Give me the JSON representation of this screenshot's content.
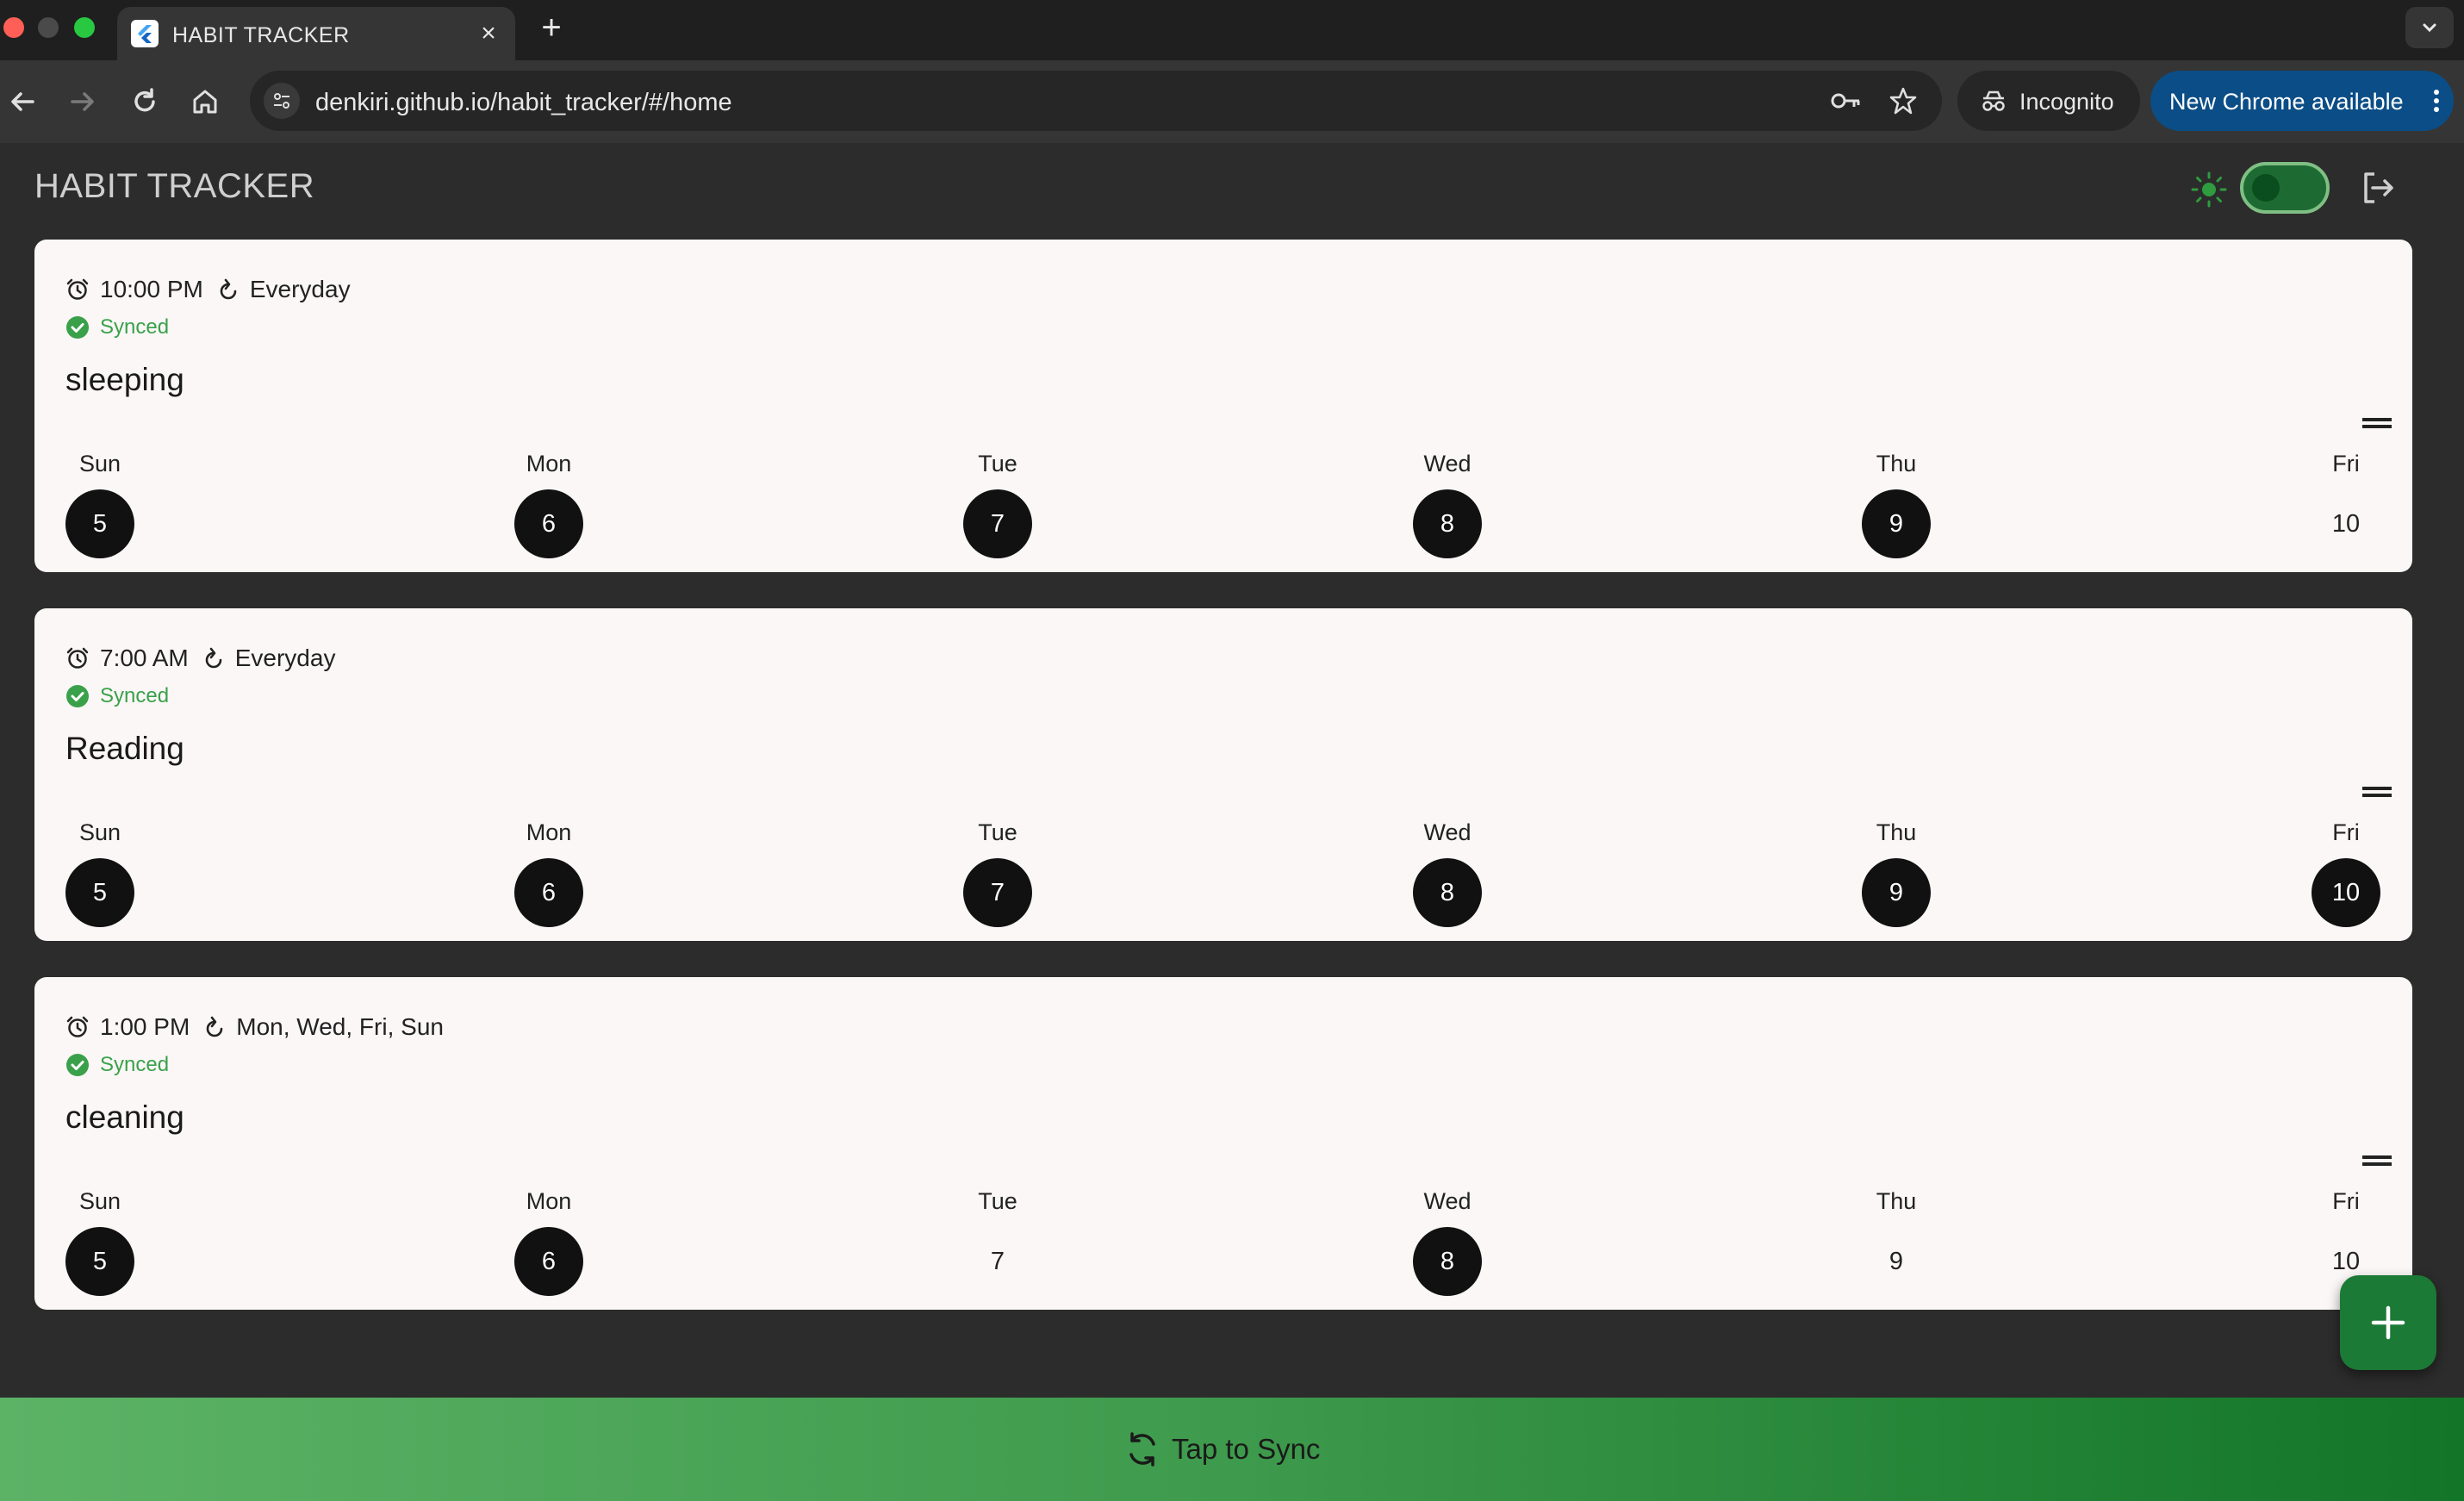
{
  "browser": {
    "tab_title": "HABIT TRACKER",
    "url": "denkiri.github.io/habit_tracker/#/home",
    "incognito_label": "Incognito",
    "update_label": "New Chrome available"
  },
  "app": {
    "title": "HABIT TRACKER",
    "theme_switch_on": true,
    "accent_color": "#1b7a35",
    "synced_color": "#3aa14a"
  },
  "habits": [
    {
      "time": "10:00 PM",
      "repeat": "Everyday",
      "status": "Synced",
      "name": "sleeping",
      "days": [
        {
          "label": "Sun",
          "num": "5",
          "done": true
        },
        {
          "label": "Mon",
          "num": "6",
          "done": true
        },
        {
          "label": "Tue",
          "num": "7",
          "done": true
        },
        {
          "label": "Wed",
          "num": "8",
          "done": true
        },
        {
          "label": "Thu",
          "num": "9",
          "done": true
        },
        {
          "label": "Fri",
          "num": "10",
          "done": false
        }
      ]
    },
    {
      "time": "7:00 AM",
      "repeat": "Everyday",
      "status": "Synced",
      "name": "Reading",
      "days": [
        {
          "label": "Sun",
          "num": "5",
          "done": true
        },
        {
          "label": "Mon",
          "num": "6",
          "done": true
        },
        {
          "label": "Tue",
          "num": "7",
          "done": true
        },
        {
          "label": "Wed",
          "num": "8",
          "done": true
        },
        {
          "label": "Thu",
          "num": "9",
          "done": true
        },
        {
          "label": "Fri",
          "num": "10",
          "done": true
        }
      ]
    },
    {
      "time": "1:00 PM",
      "repeat": "Mon, Wed, Fri, Sun",
      "status": "Synced",
      "name": "cleaning",
      "days": [
        {
          "label": "Sun",
          "num": "5",
          "done": true
        },
        {
          "label": "Mon",
          "num": "6",
          "done": true
        },
        {
          "label": "Tue",
          "num": "7",
          "done": false
        },
        {
          "label": "Wed",
          "num": "8",
          "done": true
        },
        {
          "label": "Thu",
          "num": "9",
          "done": false
        },
        {
          "label": "Fri",
          "num": "10",
          "done": false
        }
      ]
    }
  ],
  "sync_bar": {
    "label": "Tap to Sync"
  }
}
